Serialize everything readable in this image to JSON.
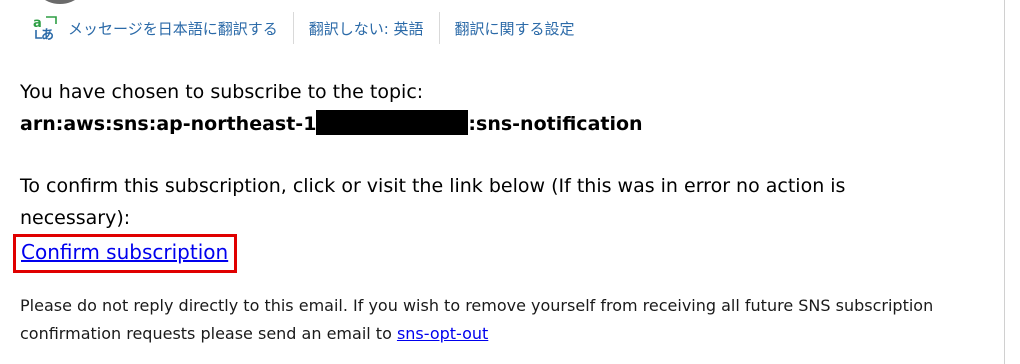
{
  "translate_bar": {
    "translate_label": "メッセージを日本語に翻訳する",
    "no_translate_label": "翻訳しない: 英語",
    "settings_label": "翻訳に関する設定",
    "accent_color": "#2b6aa8"
  },
  "message": {
    "intro": "You have chosen to subscribe to the topic:",
    "arn_prefix": "arn:aws:sns:ap-northeast-1",
    "arn_suffix": ":sns-notification",
    "confirm_text": "To confirm this subscription, click or visit the link below (If this was in error no action is necessary):",
    "confirm_link": "Confirm subscription",
    "footer_text": "Please do not reply directly to this email. If you wish to remove yourself from receiving all future SNS subscription confirmation requests please send an email to ",
    "optout_link": "sns-opt-out",
    "highlight_color": "#e00000",
    "link_color": "#0000ee"
  }
}
